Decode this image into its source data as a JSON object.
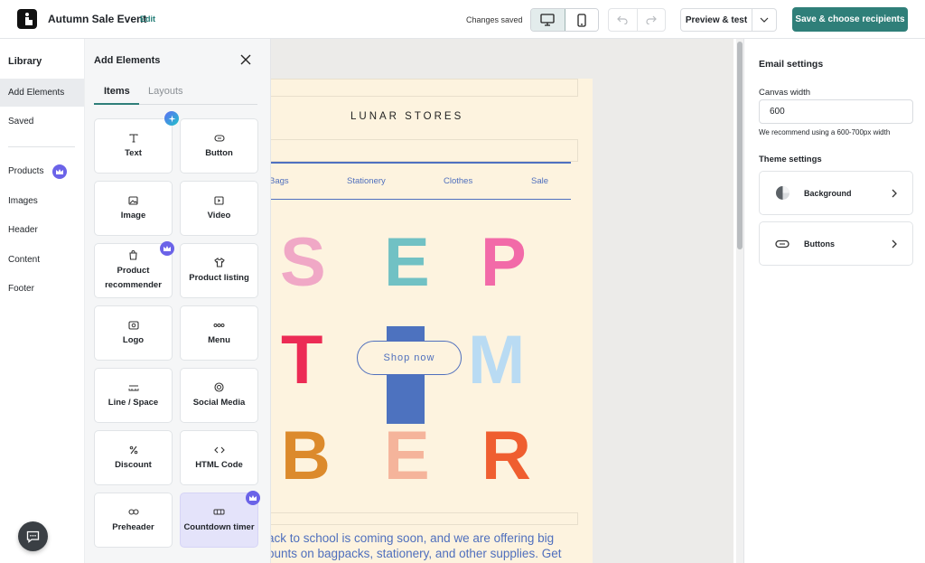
{
  "header": {
    "title": "Autumn Sale Event",
    "edit_label": "Edit",
    "status": "Changes saved",
    "preview_label": "Preview & test",
    "save_label": "Save & choose recipients"
  },
  "library": {
    "title": "Library",
    "items": [
      {
        "label": "Add Elements"
      },
      {
        "label": "Saved"
      },
      {
        "label": "Products"
      },
      {
        "label": "Images"
      },
      {
        "label": "Header"
      },
      {
        "label": "Content"
      },
      {
        "label": "Footer"
      }
    ]
  },
  "add_panel": {
    "title": "Add Elements",
    "tabs": [
      "Items",
      "Layouts"
    ],
    "cards": [
      {
        "label": "Text",
        "icon": "text-icon"
      },
      {
        "label": "Button",
        "icon": "button-icon"
      },
      {
        "label": "Image",
        "icon": "image-icon"
      },
      {
        "label": "Video",
        "icon": "video-icon"
      },
      {
        "label": "Product\nrecommender",
        "icon": "product-recommender-icon"
      },
      {
        "label": "Product listing",
        "icon": "shirt-icon"
      },
      {
        "label": "Logo",
        "icon": "logo-icon"
      },
      {
        "label": "Menu",
        "icon": "menu-icon"
      },
      {
        "label": "Line / Space",
        "icon": "line-space-icon"
      },
      {
        "label": "Social Media",
        "icon": "social-media-icon"
      },
      {
        "label": "Discount",
        "icon": "percent-icon"
      },
      {
        "label": "HTML Code",
        "icon": "code-icon"
      },
      {
        "label": "Preheader",
        "icon": "link-icon"
      },
      {
        "label": "Countdown timer",
        "icon": "countdown-icon"
      }
    ]
  },
  "email": {
    "brand": "LUNAR STORES",
    "nav": [
      "Bags",
      "Stationery",
      "Clothes",
      "Sale"
    ],
    "letters": [
      {
        "char": "S",
        "color": "#f0a8c6"
      },
      {
        "char": "E",
        "color": "#71c1c4"
      },
      {
        "char": "P",
        "color": "#f26aa8"
      },
      {
        "char": "T",
        "color": "#ec2b55"
      },
      {
        "char": "M",
        "color": "#b9dbf3"
      },
      {
        "char": "B",
        "color": "#dc8a2c"
      },
      {
        "char": "E",
        "color": "#f5b49b"
      },
      {
        "char": "R",
        "color": "#ef5e30"
      }
    ],
    "shop_label": "Shop now",
    "body_line1": "ack to school is coming soon, and we are offering big",
    "body_line2": "ounts on bagpacks, stationery, and other supplies. Get"
  },
  "settings": {
    "title": "Email settings",
    "canvas_width_label": "Canvas width",
    "canvas_width_value": "600",
    "hint": "We recommend using a 600-700px width",
    "theme_label": "Theme settings",
    "theme_items": [
      "Background",
      "Buttons"
    ]
  },
  "colors": {
    "accent": "#2f7f79",
    "premium": "#6b63e8",
    "email_bg": "#fdf3df",
    "email_blue": "#4f6fbd"
  }
}
